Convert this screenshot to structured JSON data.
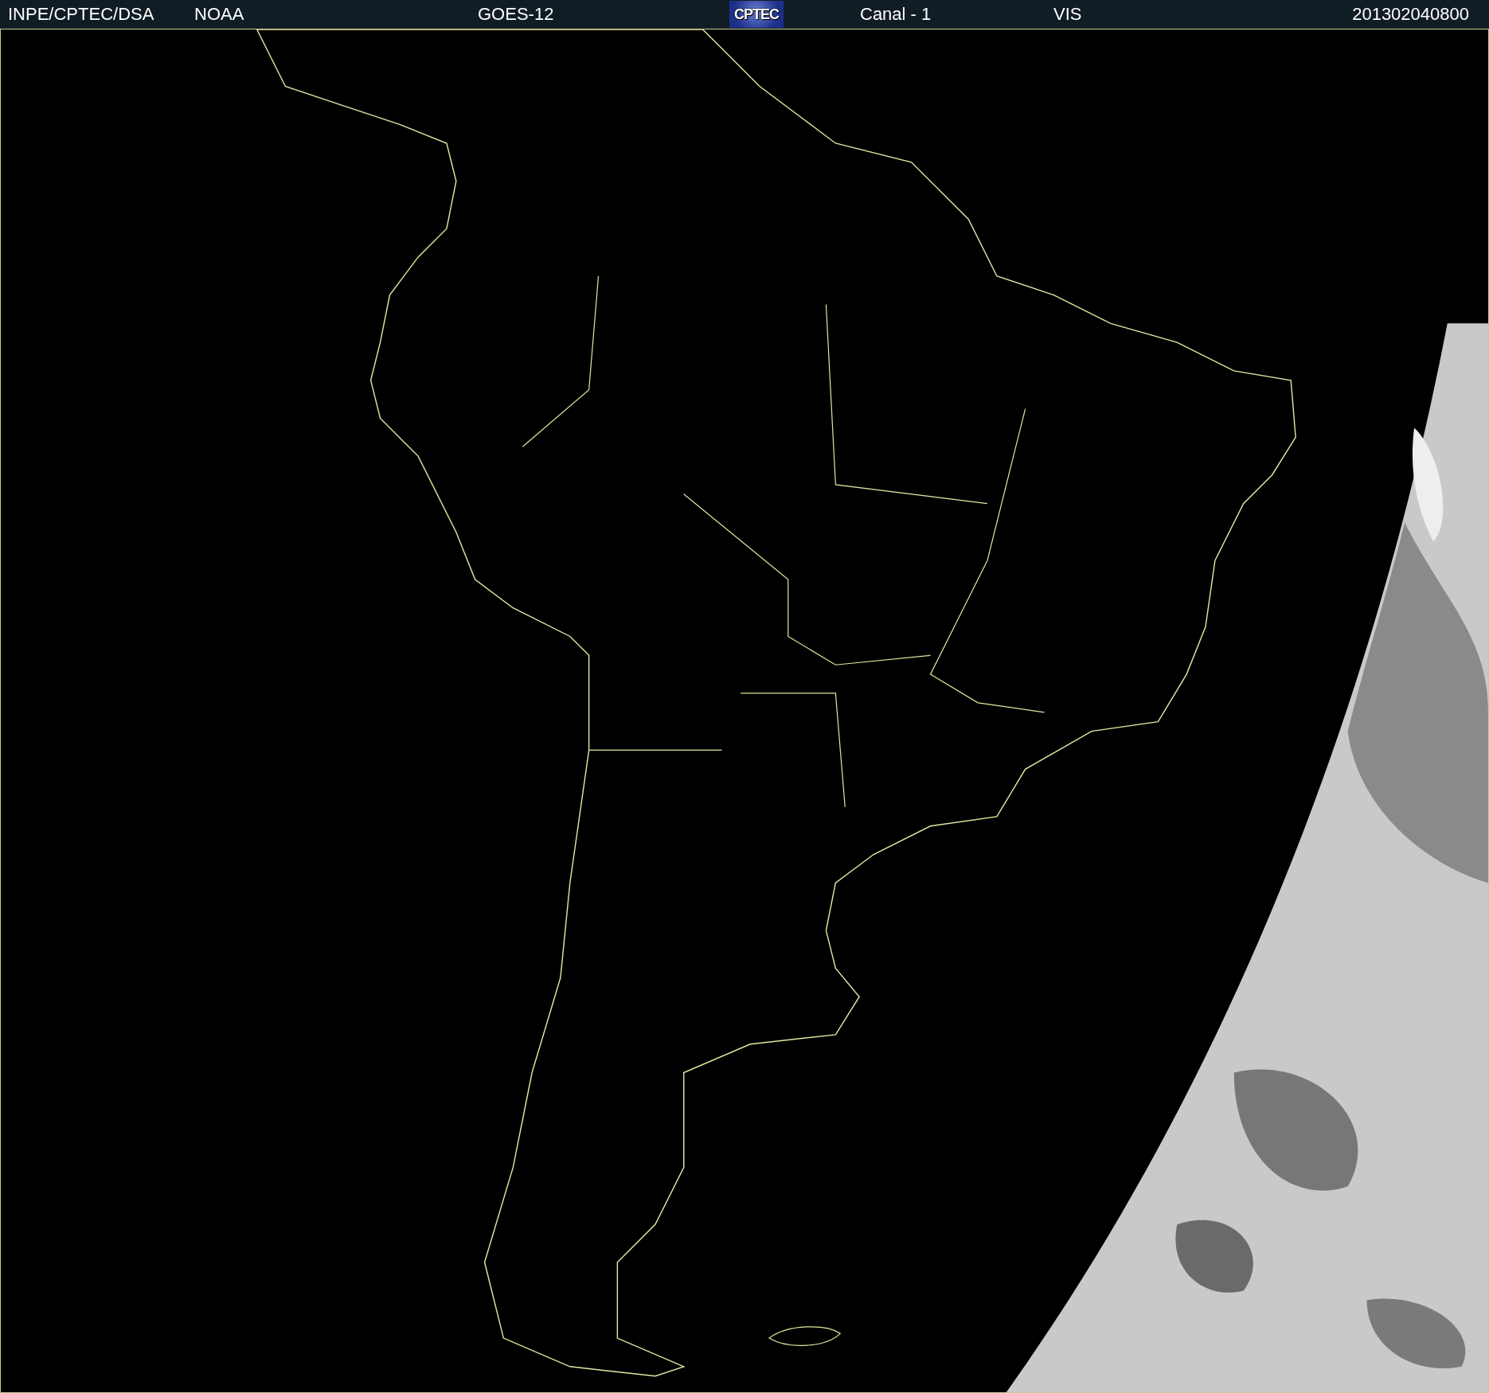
{
  "header": {
    "items": [
      {
        "kind": "text",
        "text": "INPE/CPTEC/DSA"
      },
      {
        "kind": "text",
        "text": "NOAA"
      },
      {
        "kind": "text",
        "text": "GOES-12"
      },
      {
        "kind": "logo",
        "text": "CPTEC"
      },
      {
        "kind": "text",
        "text": "Canal - 1"
      },
      {
        "kind": "text",
        "text": "VIS"
      },
      {
        "kind": "text",
        "text": "201302040800"
      }
    ]
  }
}
